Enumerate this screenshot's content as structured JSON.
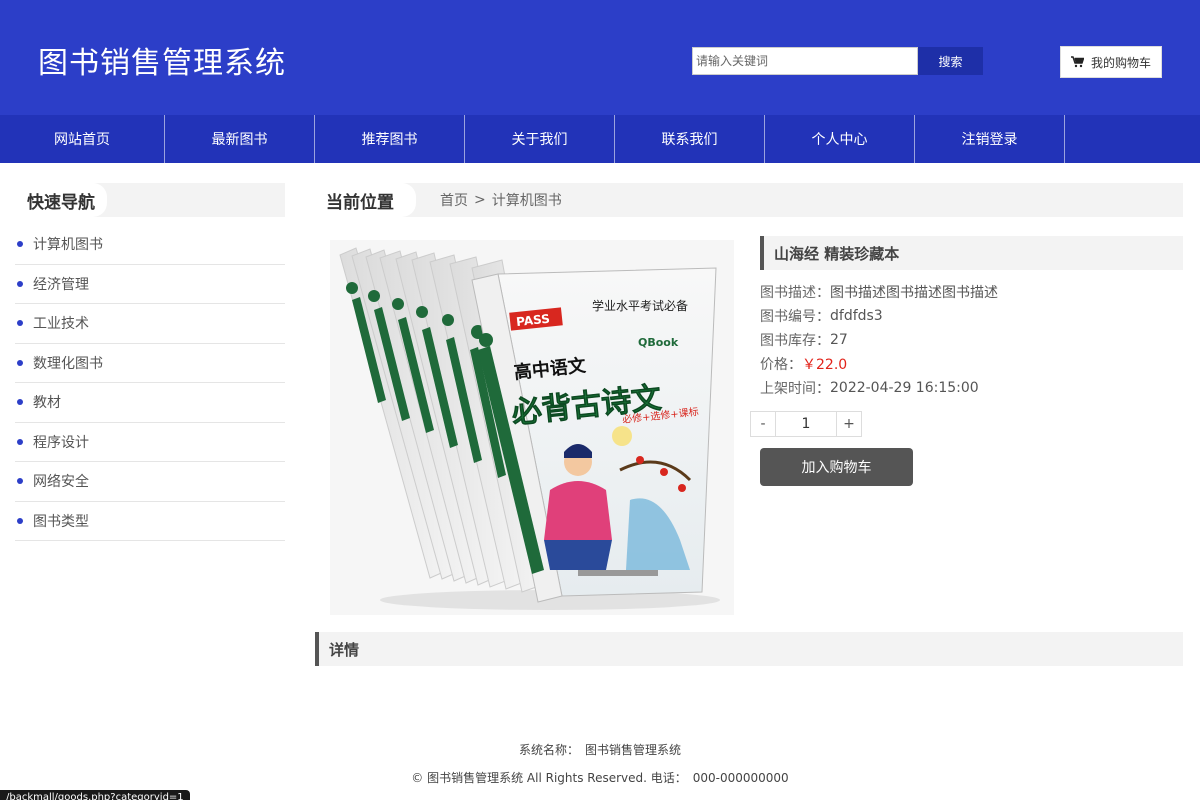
{
  "header": {
    "title": "图书销售管理系统",
    "search_placeholder": "请输入关键词",
    "search_button": "搜索",
    "cart_label": "我的购物车",
    "cart_icon": "cart-icon"
  },
  "nav": {
    "items": [
      "网站首页",
      "最新图书",
      "推荐图书",
      "关于我们",
      "联系我们",
      "个人中心",
      "注销登录"
    ]
  },
  "sidebar": {
    "title": "快速导航",
    "items": [
      "计算机图书",
      "经济管理",
      "工业技术",
      "数理化图书",
      "教材",
      "程序设计",
      "网络安全",
      "图书类型"
    ]
  },
  "breadcrumb": {
    "title": "当前位置",
    "home": "首页",
    "separator": ">",
    "current": "计算机图书"
  },
  "product": {
    "name": "山海经 精装珍藏本",
    "desc_label": "图书描述：",
    "desc": "图书描述图书描述图书描述",
    "code_label": "图书编号：",
    "code": "dfdfds3",
    "stock_label": "图书库存：",
    "stock": "27",
    "price_label": "价格：",
    "price": "￥22.0",
    "time_label": "上架时间：",
    "time": "2022-04-29 16:15:00",
    "qty_minus": "-",
    "qty": "1",
    "qty_plus": "+",
    "add_cart": "加入购物车",
    "image": {
      "publisher_badge": "PASS",
      "top_text": "学业水平考试必备",
      "series": "高中语文",
      "main_title": "必背古诗文",
      "subtitle": "必修+选修+课标",
      "brand": "QBook"
    }
  },
  "detail": {
    "title": "详情"
  },
  "footer": {
    "line1": "系统名称：　图书销售管理系统",
    "line2": "© 图书销售管理系统 All Rights Reserved. 电话：　000-000000000"
  },
  "status_url": "/backmall/goods.php?categoryid=1",
  "colors": {
    "header_bg": "#2c3ec8",
    "nav_bg": "#2233b8",
    "price": "#e2231a",
    "button_dark": "#555555"
  }
}
